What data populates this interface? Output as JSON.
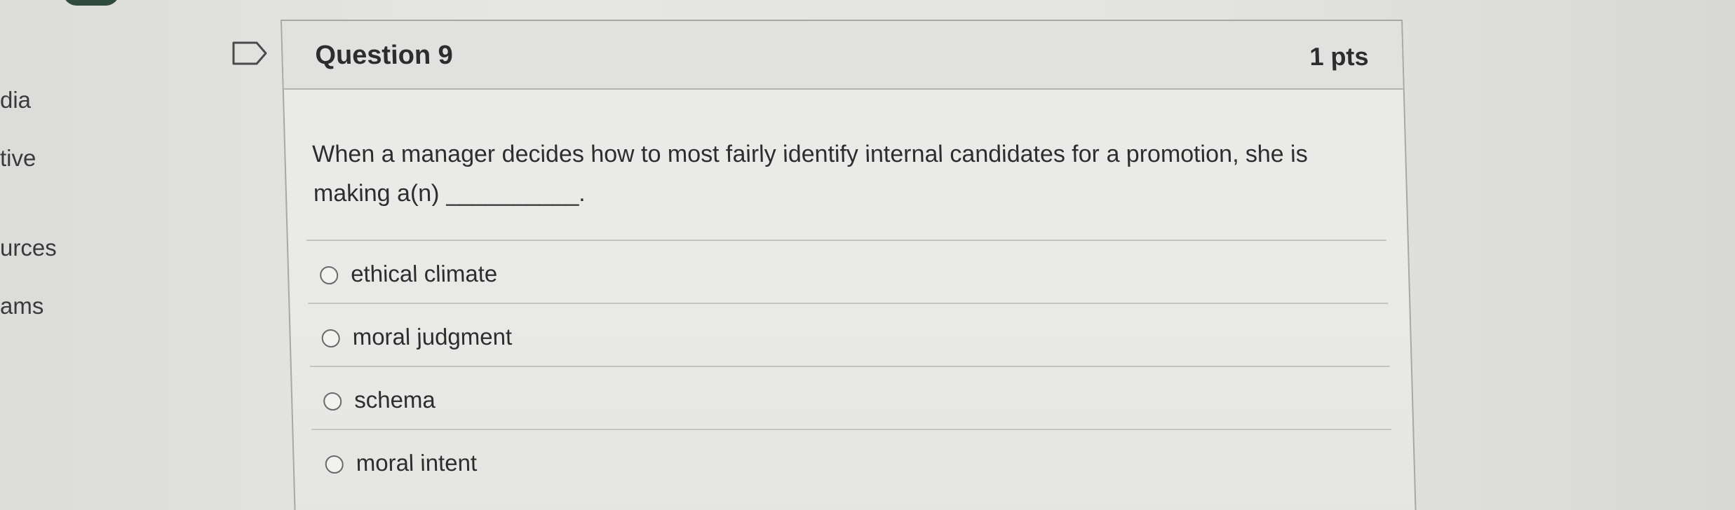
{
  "nav": {
    "items": [
      "dia",
      "tive",
      "urces",
      "ams"
    ]
  },
  "question": {
    "title": "Question 9",
    "points": "1 pts",
    "text": "When a manager decides how to most fairly identify internal candidates for a promotion, she is making a(n) __________."
  },
  "answers": [
    {
      "label": "ethical climate",
      "selected": false
    },
    {
      "label": "moral judgment",
      "selected": false
    },
    {
      "label": "schema",
      "selected": false
    },
    {
      "label": "moral intent",
      "selected": false
    }
  ],
  "icons": {
    "flag": "flag-icon",
    "radio": "radio-icon"
  },
  "colors": {
    "background": "#e4e4e2",
    "card_border": "#a8a8a6",
    "text": "#2d2d2d"
  }
}
